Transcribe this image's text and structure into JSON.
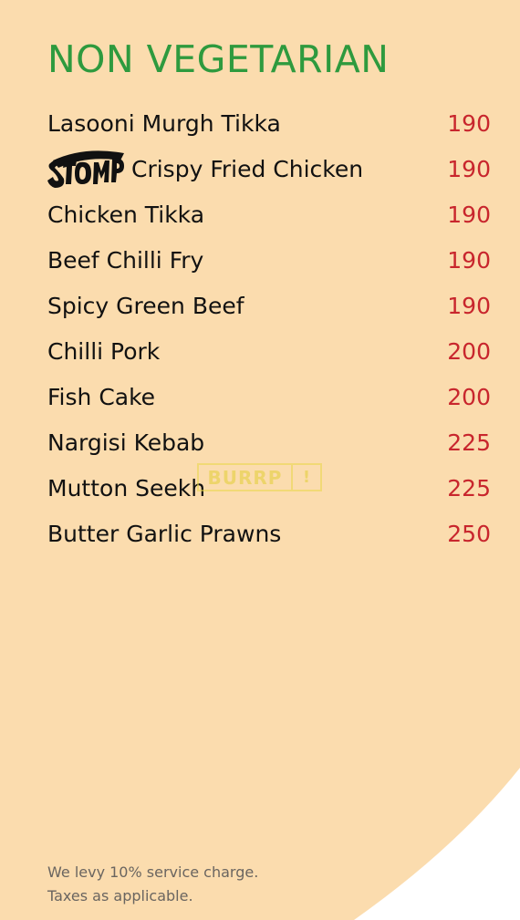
{
  "page": {
    "title": "NON VEGETARIAN",
    "colors": {
      "background": "#fbdcae",
      "corner": "#ffffff",
      "title": "#2e9a3e",
      "item_text": "#111111",
      "price_text": "#c8262d",
      "footer_text": "#6a6560"
    }
  },
  "menu": {
    "items": [
      {
        "name": "Lasooni Murgh Tikka",
        "price": "190"
      },
      {
        "name": "Crispy Fried Chicken",
        "price": "190",
        "logo": "Stomp"
      },
      {
        "name": "Chicken Tikka",
        "price": "190"
      },
      {
        "name": "Beef Chilli Fry",
        "price": "190"
      },
      {
        "name": "Spicy Green Beef",
        "price": "190"
      },
      {
        "name": "Chilli Pork",
        "price": "200"
      },
      {
        "name": "Fish Cake",
        "price": "200"
      },
      {
        "name": "Nargisi Kebab",
        "price": "225"
      },
      {
        "name": "Mutton Seekh",
        "price": "225"
      },
      {
        "name": "Butter Garlic Prawns",
        "price": "250"
      }
    ]
  },
  "watermark": {
    "text": "BURRP",
    "symbol": "!"
  },
  "footer": {
    "line1": "We levy 10% service charge.",
    "line2": "Taxes as applicable."
  }
}
